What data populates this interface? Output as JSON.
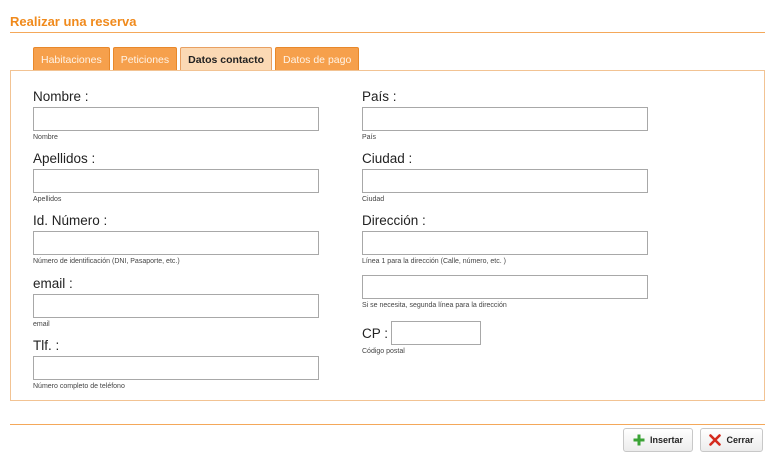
{
  "page": {
    "title": "Realizar una reserva"
  },
  "tabs": [
    {
      "label": "Habitaciones",
      "active": false
    },
    {
      "label": "Peticiones",
      "active": false
    },
    {
      "label": "Datos contacto",
      "active": true
    },
    {
      "label": "Datos de pago",
      "active": false
    }
  ],
  "form": {
    "nombre": {
      "label": "Nombre :",
      "value": "",
      "help": "Nombre"
    },
    "apellidos": {
      "label": "Apellidos :",
      "value": "",
      "help": "Apellidos"
    },
    "id_numero": {
      "label": "Id. Número :",
      "value": "",
      "help": "Número de identificación (DNI, Pasaporte, etc.)"
    },
    "email": {
      "label": "email :",
      "value": "",
      "help": "email"
    },
    "tlf": {
      "label": "Tlf. :",
      "value": "",
      "help": "Número completo de teléfono"
    },
    "pais": {
      "label": "País :",
      "value": "",
      "help": "País"
    },
    "ciudad": {
      "label": "Ciudad :",
      "value": "",
      "help": "Ciudad"
    },
    "direccion": {
      "label": "Dirección :",
      "value": "",
      "help": "Línea 1 para la dirección (Calle, número, etc. )"
    },
    "direccion2": {
      "value": "",
      "help": "Si se necesita, segunda línea para la dirección"
    },
    "cp": {
      "label": "CP :",
      "value": "",
      "help": "Código postal"
    }
  },
  "buttons": {
    "insert_label": "Insertar",
    "close_label": "Cerrar"
  },
  "icons": {
    "insert": "plus-icon",
    "close": "x-icon"
  },
  "colors": {
    "accent": "#f08a1c",
    "tab": "#f6a04c",
    "tab_active": "#fbd9b4",
    "insert_icon": "#3aa335",
    "close_icon": "#d42a1e"
  }
}
